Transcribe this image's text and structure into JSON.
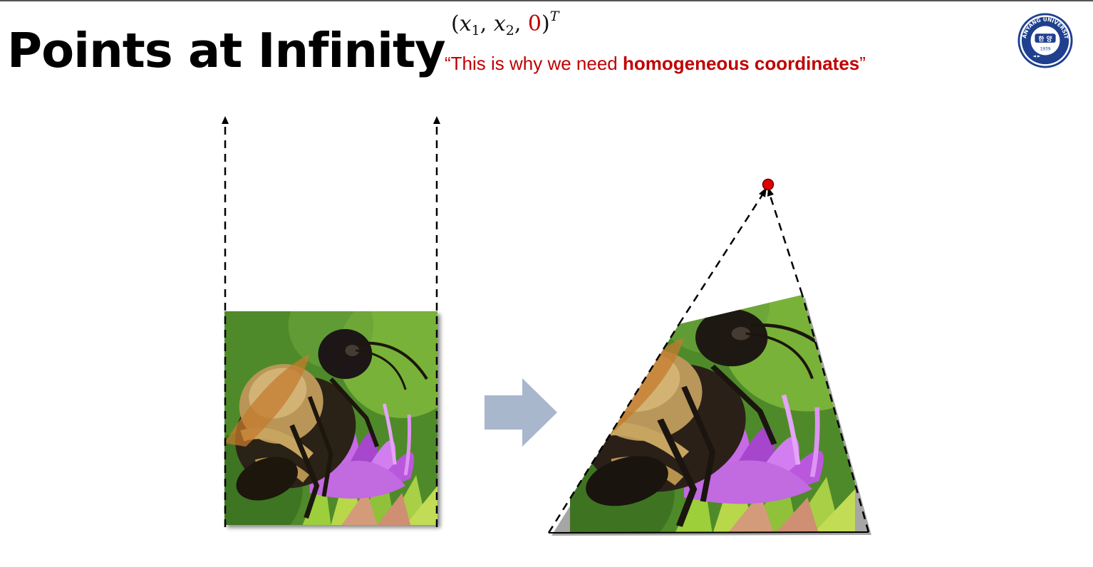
{
  "slide": {
    "title": "Points at Infinity",
    "formula": {
      "open": "(",
      "var1": "x",
      "sub1": "1",
      "comma1": ", ",
      "var2": "x",
      "sub2": "2",
      "comma2": ", ",
      "zero": "0",
      "close": ")",
      "sup": "T"
    },
    "quote": {
      "prefix": "“This is why we need ",
      "emphasis": "homogeneous coordinates",
      "suffix": "”"
    },
    "logo": {
      "name": "Hanyang University seal",
      "arc_text": "HANYANG UNIVERSITY",
      "center_text": "한 양",
      "year": "1939",
      "color": "#1f3f8f"
    },
    "colors": {
      "accent_red": "#c00000",
      "vanishing_point": "#e00000",
      "arrow_fill": "#a9b7cc",
      "dash": "#000000"
    },
    "figure": {
      "left_image": "bee-on-purple-flower photo (square)",
      "right_image": "same photo, projectively warped",
      "transform_arrow": "block-right-arrow"
    }
  }
}
